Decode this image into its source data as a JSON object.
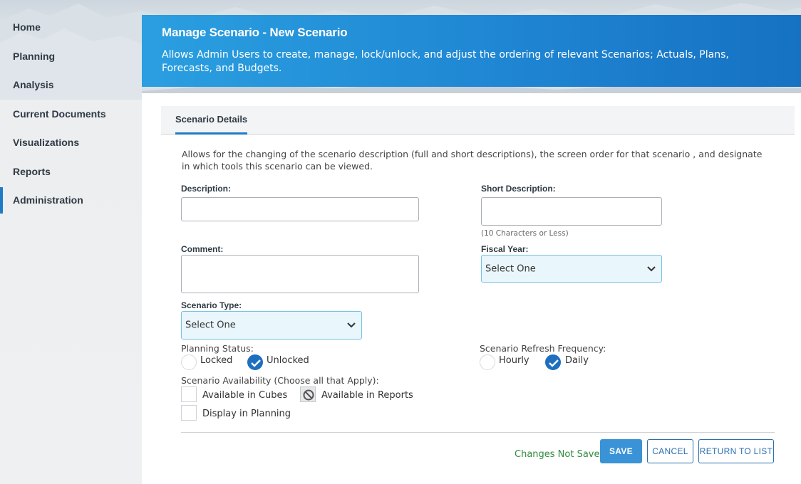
{
  "nav": {
    "items": [
      {
        "label": "Home"
      },
      {
        "label": "Planning"
      },
      {
        "label": "Analysis"
      },
      {
        "label": "Current Documents"
      },
      {
        "label": "Visualizations"
      },
      {
        "label": "Reports"
      },
      {
        "label": "Administration",
        "active": true
      }
    ]
  },
  "header": {
    "title": "Manage Scenario - New Scenario",
    "description": "Allows Admin Users to create, manage, lock/unlock, and adjust the ordering of relevant Scenarios; Actuals, Plans, Forecasts, and Budgets."
  },
  "tabs": [
    {
      "label": "Scenario Details",
      "active": true
    }
  ],
  "form": {
    "intro": "Allows for the changing of the scenario description (full and short descriptions), the screen order for that scenario , and designate in which tools this scenario can be viewed.",
    "description_label": "Description:",
    "description_value": "",
    "short_description_label": "Short Description:",
    "short_description_value": "",
    "short_description_hint": "(10 Characters or Less)",
    "comment_label": "Comment:",
    "comment_value": "",
    "fiscal_year_label": "Fiscal Year:",
    "fiscal_year_value": "Select One",
    "scenario_type_label": "Scenario Type:",
    "scenario_type_value": "Select One",
    "planning_status_label": "Planning Status:",
    "planning_status_options": [
      "Locked",
      "Unlocked"
    ],
    "planning_status_selected": "Unlocked",
    "refresh_frequency_label": "Scenario Refresh Frequency:",
    "refresh_frequency_options": [
      "Hourly",
      "Daily"
    ],
    "refresh_frequency_selected": "Daily",
    "availability_label": "Scenario Availability (Choose all that Apply):",
    "availability_options": [
      {
        "label": "Available in Cubes",
        "checked": false,
        "disabled": false
      },
      {
        "label": "Available in Reports",
        "checked": false,
        "disabled": true
      },
      {
        "label": "Display in Planning",
        "checked": false,
        "disabled": false
      }
    ]
  },
  "footer": {
    "status": "Changes Not Saved",
    "save_label": "SAVE",
    "cancel_label": "CANCEL",
    "return_label": "RETURN TO LIST"
  },
  "colors": {
    "accent": "#1e6fbf",
    "header_gradient_start": "#2a9fe0",
    "header_gradient_end": "#1671c2",
    "status_text": "#2e8b3d"
  }
}
